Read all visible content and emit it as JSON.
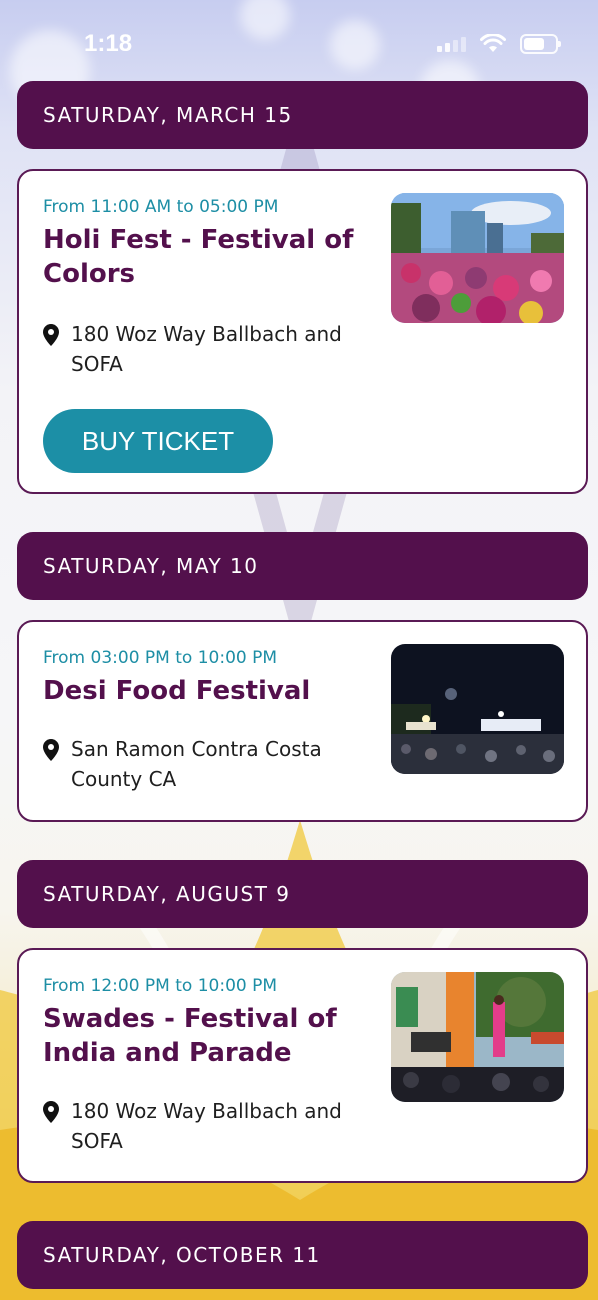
{
  "status_bar": {
    "time": "1:18"
  },
  "events": [
    {
      "date": "SATURDAY, MARCH 15",
      "time": "From 11:00 AM to 05:00 PM",
      "title": "Holi Fest - Festival of Colors",
      "location": "180 Woz Way Ballbach and SOFA",
      "button": "BUY TICKET",
      "image": "holi-crowd-photo"
    },
    {
      "date": "SATURDAY, MAY 10",
      "time": "From 03:00 PM to 10:00 PM",
      "title": "Desi Food Festival",
      "location": "San Ramon Contra Costa County CA",
      "image": "night-festival-photo"
    },
    {
      "date": "SATURDAY, AUGUST 9",
      "time": "From 12:00 PM to 10:00 PM",
      "title": "Swades - Festival of India and Parade",
      "location": "180 Woz Way Ballbach and SOFA",
      "image": "stage-performance-photo"
    },
    {
      "date": "SATURDAY, OCTOBER 11"
    }
  ],
  "colors": {
    "header_bg": "#53104c",
    "accent": "#1c8fa6",
    "title": "#53104c"
  }
}
